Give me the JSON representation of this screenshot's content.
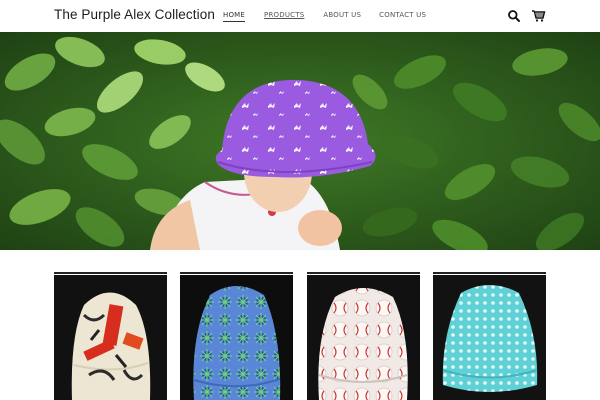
{
  "site": {
    "title": "The Purple Alex Collection"
  },
  "nav": {
    "items": [
      {
        "label": "HOME"
      },
      {
        "label": "PRODUCTS"
      },
      {
        "label": "ABOUT US"
      },
      {
        "label": "CONTACT US"
      }
    ]
  },
  "icons": {
    "search": "search-icon",
    "cart": "cart-icon"
  },
  "hero": {
    "image": "child-in-purple-bucket-hat-among-green-leaves"
  },
  "products": [
    {
      "image": "cream-red-asian-print-bucket-hat"
    },
    {
      "image": "blue-green-starburst-bucket-hat"
    },
    {
      "image": "baseball-print-bucket-hat"
    },
    {
      "image": "turquoise-polka-dot-bucket-hat"
    }
  ],
  "colors": {
    "hat_purple": "#9b59d6",
    "leaf_green": "#4e8a2e",
    "text": "#1d1d1d"
  }
}
